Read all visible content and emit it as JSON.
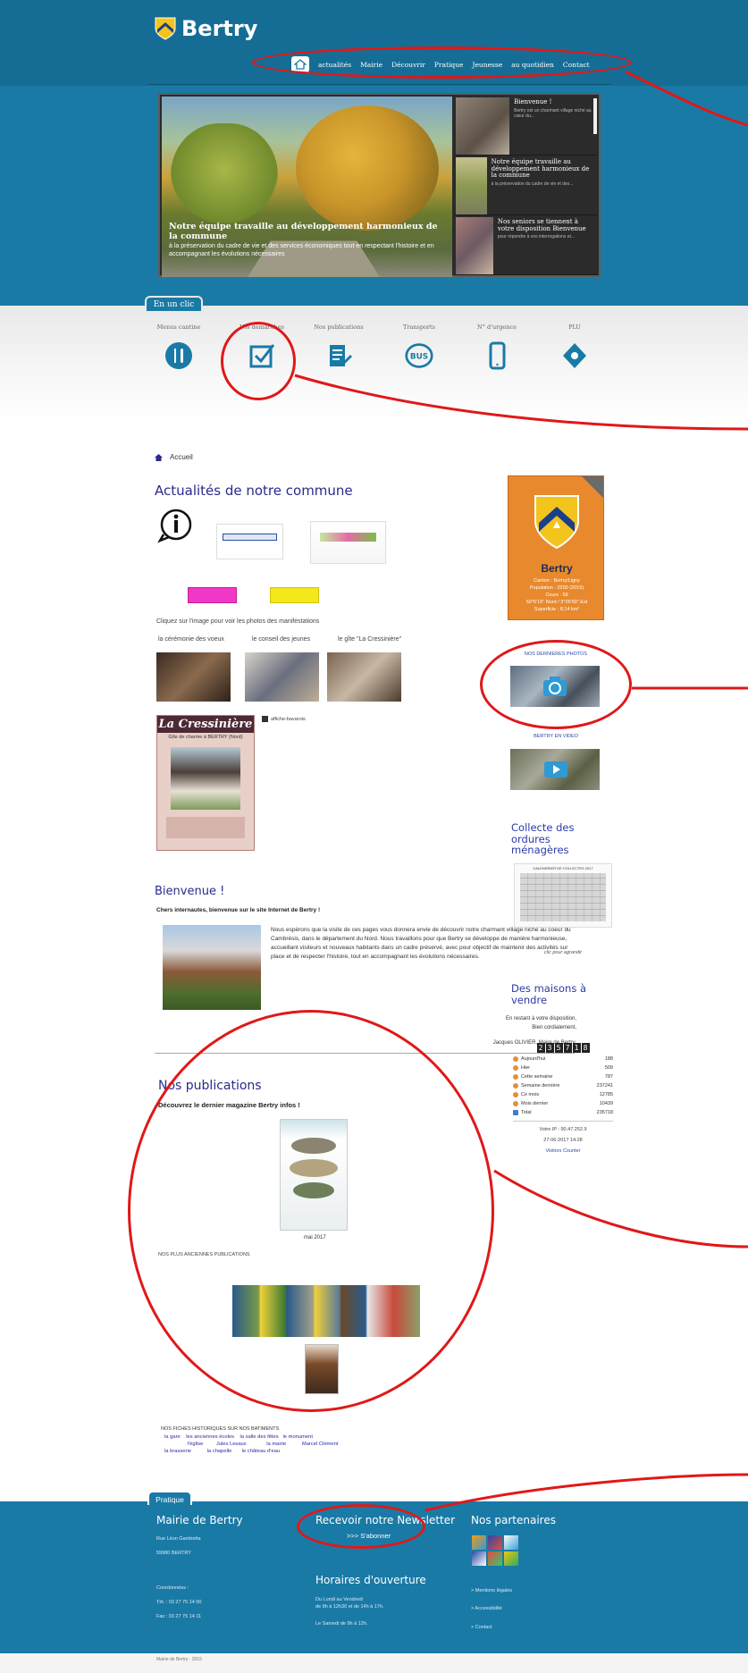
{
  "header": {
    "site_name": "Bertry",
    "nav": [
      "actualités",
      "Mairie",
      "Découvrir",
      "Pratique",
      "Jeunesse",
      "au quotidien",
      "Contact"
    ]
  },
  "slider": {
    "main_title": "Notre équipe travaille au développement harmonieux de la commune",
    "main_desc": "à la préservation du cadre de vie et des services économiques tout en respectant l'histoire et en accompagnant les évolutions nécessaires",
    "thumbs": [
      {
        "title": "Bienvenue !",
        "desc": "Bertry est un charmant village niché au cœur du..."
      },
      {
        "title": "Notre équipe travaille au développement harmonieux de la commune",
        "desc": "à la préservation du cadre de vie et des..."
      },
      {
        "title": "Nos seniors se tiennent à votre disposition Bienvenue",
        "desc": "pour répondre à vos interrogations et..."
      }
    ]
  },
  "clic": {
    "tab": "En un clic",
    "items": [
      {
        "label": "Menus cantine",
        "icon": "utensils-icon"
      },
      {
        "label": "Vos démarches",
        "icon": "checkbox-icon"
      },
      {
        "label": "Nos publications",
        "icon": "document-edit-icon"
      },
      {
        "label": "Transports",
        "icon": "bus-icon"
      },
      {
        "label": "N° d'urgence",
        "icon": "phone-icon"
      },
      {
        "label": "PLU",
        "icon": "map-marker-icon"
      }
    ]
  },
  "main": {
    "breadcrumb": "Accueil",
    "actualites_title": "Actualités de notre commune",
    "photos_caption": "Cliquez sur l'image pour voir les photos des manifestations",
    "photo_labels": [
      "la cérémonie des voeux",
      "le conseil des jeunes",
      "le gîte \"La Cressinière\""
    ],
    "gite_name": "La Cressinière",
    "gite_sub": "Gîte de charme à BERTRY (Nord)",
    "affiche_label": "affiche-bavarois",
    "welcome_title": "Bienvenue !",
    "welcome_lead": "Chers internautes, bienvenue sur le site Internet de Bertry !",
    "welcome_text": "Nous espérons que la visite de ces pages vous donnera envie de découvrir notre charmant village niché au coeur du Cambrésis, dans le département du Nord. Nous travaillons pour que Bertry se développe de manière harmonieuse, accueillant visiteurs et nouveaux habitants dans un cadre préservé, avec pour objectif de maintenir des activités sur place et de respecter l'histoire, tout en accompagnant les évolutions nécessaires.",
    "welcome_sign1": "En restant à votre disposition,",
    "welcome_sign2": "Bien cordialement,",
    "welcome_sign3": "Jacques OLIVIER, Maire de Bertry.",
    "pub_title": "Nos publications",
    "pub_lead": "Découvrez le dernier magazine Bertry infos !",
    "pub_date": "mai 2017",
    "pub_older": "NOS PLUS ANCIENNES PUBLICATIONS",
    "fiches_title": "NOS FICHES HISTORIQUES SUR NOS BATIMENTS",
    "fiches_links": [
      "la gare",
      "les anciennes écoles",
      "la salle des fêtes",
      "le monument",
      "l'église",
      "Jules Lesaux",
      "la mairie",
      "Marcel Clément",
      "la brasserie",
      "la chapelle",
      "le château d'eau"
    ]
  },
  "sidebar": {
    "city": "Bertry",
    "info": [
      "Canton : Bertry/Ligny",
      "Population : 2200 (2015)",
      "Cours : 59",
      "50°5'16\" Nord / 3°26'50\" Est",
      "Superficie : 8,14 km²"
    ],
    "photos_label": "NOS DERNIERES PHOTOS",
    "video_label": "BERTRY EN VIDEO",
    "collecte_title": "Collecte des ordures ménagères",
    "calendar_title": "CALENDRIER DE COLLECTES 2017",
    "collecte_caption": "clic pour agrandir",
    "maisons_title": "Des maisons à vendre",
    "counter_digits": [
      "2",
      "3",
      "5",
      "7",
      "1",
      "8"
    ],
    "counter_rows": [
      {
        "label": "Aujourd'hui",
        "value": "188"
      },
      {
        "label": "Hier",
        "value": "509"
      },
      {
        "label": "Cette semaine",
        "value": "787"
      },
      {
        "label": "Semaine dernière",
        "value": "237241"
      },
      {
        "label": "Ce mois",
        "value": "12785"
      },
      {
        "label": "Mois dernier",
        "value": "10439"
      },
      {
        "label": "Total",
        "value": "235718"
      }
    ],
    "ip": "Votre IP : 90.47.252.9",
    "datetime": "27-06-2017 14:28",
    "counter_link": "Visitors Counter"
  },
  "footer": {
    "tab": "Pratique",
    "mairie_title": "Mairie de Bertry",
    "mairie_addr1": "Rue Léon Gambetta",
    "mairie_addr2": "59980 BERTRY",
    "coords_label": "Coordonnées :",
    "tel": "Tél. : 03 27 75 14 00",
    "fax": "Fax : 03 27 75 14 11",
    "newsletter_title": "Recevoir notre Newsletter",
    "newsletter_link": ">>> S'abonner",
    "horaires_title": "Horaires d'ouverture",
    "horaires_1": "Du Lundi au Vendredi",
    "horaires_2": "de 9h à 12h30 et de 14h à 17h.",
    "horaires_3": "Le Samedi de 9h à 12h.",
    "partenaires_title": "Nos partenaires",
    "links": [
      "> Mentions légales",
      "> Accessibilité",
      "> Contact"
    ],
    "copyright": "Mairie de Bertry - 2015"
  }
}
